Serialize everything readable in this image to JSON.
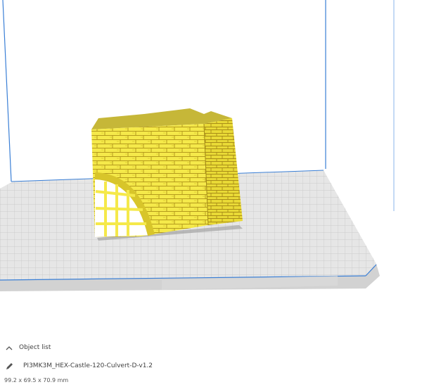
{
  "object_list": {
    "header_label": "Object list",
    "object_name": "PI3MK3M_HEX-Castle-120-Culvert-D-v1.2",
    "dimensions": "99.2 x 69.5 x 70.9 mm"
  },
  "icons": {
    "collapse": "chevron-up-icon",
    "edit": "pencil-icon"
  },
  "colors": {
    "model": "#f5e94a",
    "build_plate": "#dcdcdc",
    "volume_edge": "#3a7fd6"
  }
}
